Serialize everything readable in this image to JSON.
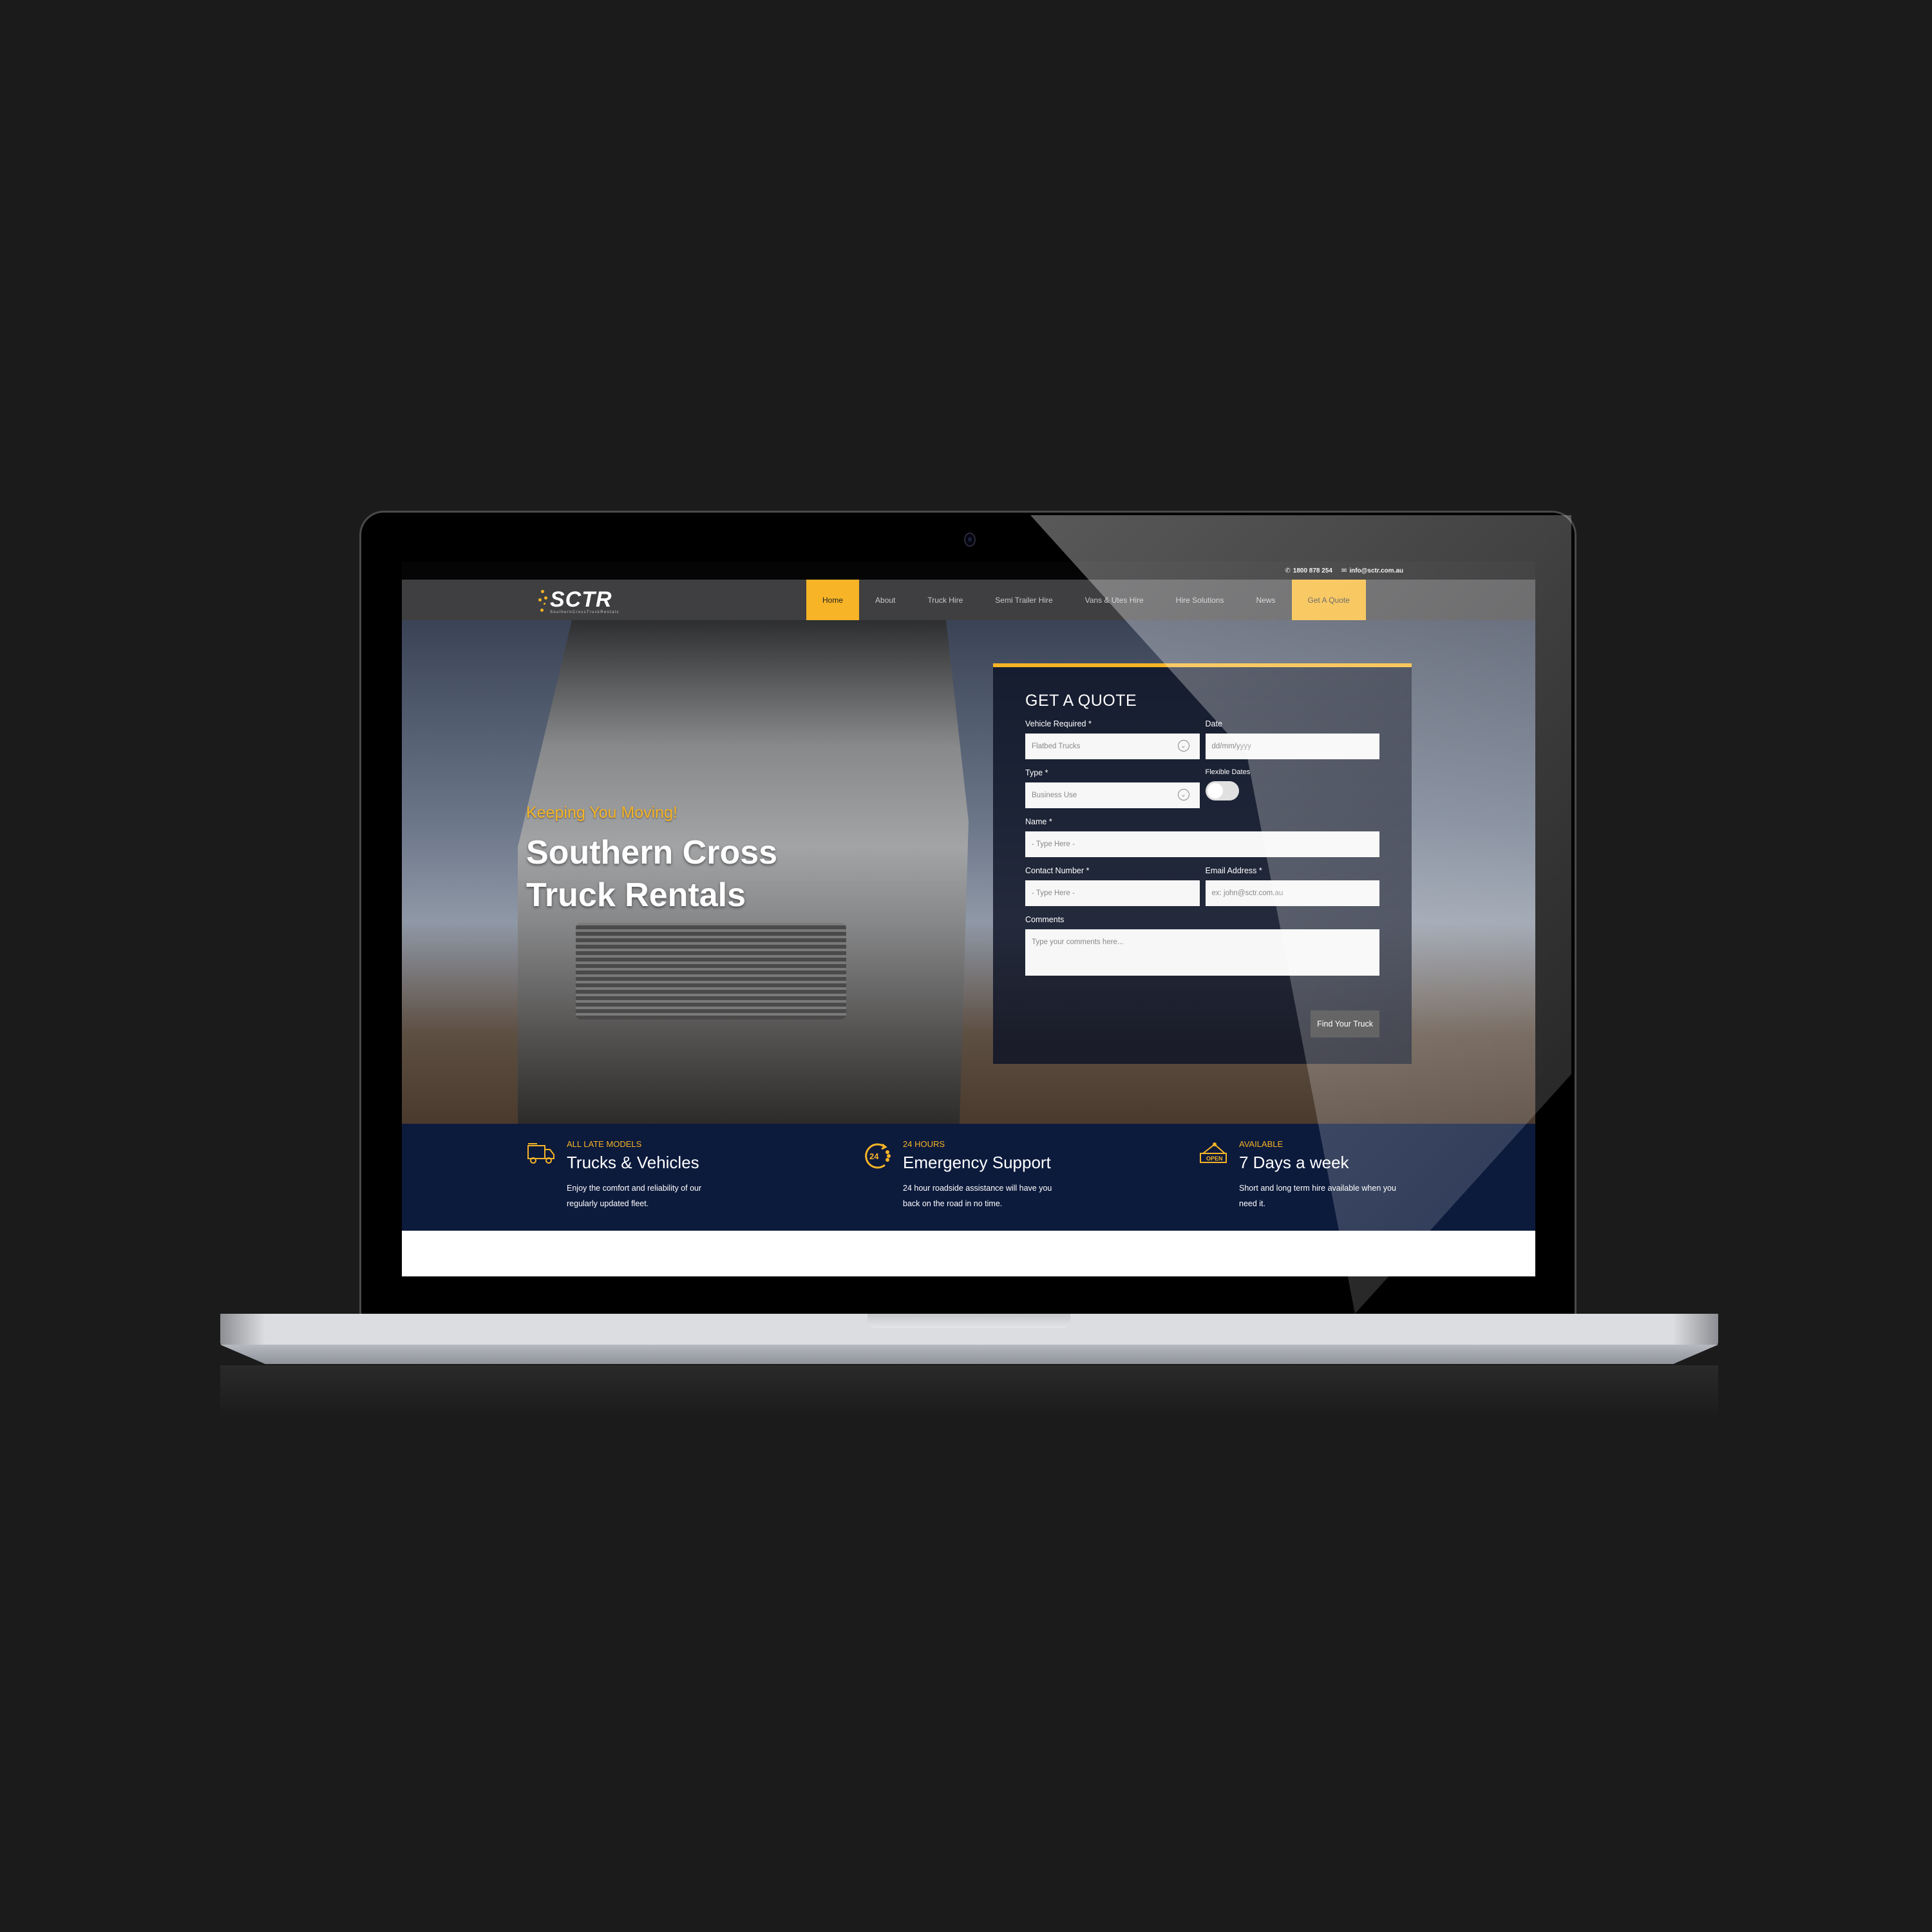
{
  "topbar": {
    "phone": "1800 878 254",
    "email": "info@sctr.com.au"
  },
  "logo": {
    "wordmark": "SCTR",
    "subtitle": "SouthernCrossTruckRentals"
  },
  "nav": {
    "items": [
      {
        "label": "Home",
        "state": "active"
      },
      {
        "label": "About"
      },
      {
        "label": "Truck Hire"
      },
      {
        "label": "Semi Trailer Hire"
      },
      {
        "label": "Vans & Utes Hire"
      },
      {
        "label": "Hire Solutions"
      },
      {
        "label": "News"
      },
      {
        "label": "Get A Quote",
        "state": "highlight"
      }
    ]
  },
  "hero": {
    "tagline": "Keeping You Moving!",
    "title_line1": "Southern Cross",
    "title_line2": "Truck Rentals"
  },
  "quote_form": {
    "heading": "GET A QUOTE",
    "vehicle_label": "Vehicle Required *",
    "vehicle_value": "Flatbed Trucks",
    "date_label": "Date",
    "date_placeholder": "dd/mm/yyyy",
    "type_label": "Type *",
    "type_value": "Business Use",
    "flexible_label": "Flexible Dates",
    "flexible_on": false,
    "name_label": "Name *",
    "name_placeholder": "- Type Here -",
    "contact_label": "Contact Number *",
    "contact_placeholder": "- Type Here -",
    "email_label": "Email Address *",
    "email_placeholder": "ex: john@sctr.com.au",
    "comments_label": "Comments",
    "comments_placeholder": "Type your comments here...",
    "submit_label": "Find Your Truck"
  },
  "features": [
    {
      "icon": "truck-icon",
      "kicker": "ALL LATE MODELS",
      "heading": "Trucks & Vehicles",
      "desc": "Enjoy the comfort and reliability of our regularly updated fleet."
    },
    {
      "icon": "24-hours-icon",
      "kicker": "24 HOURS",
      "heading": "Emergency Support",
      "desc": "24 hour roadside assistance will have you back on the road in no time."
    },
    {
      "icon": "open-sign-icon",
      "kicker": "AVAILABLE",
      "heading": "7 Days a week",
      "desc": "Short and long term hire available when you need it."
    }
  ],
  "icons": {
    "phone": "phone-icon",
    "email": "envelope-icon",
    "dropdown": "chevron-down-icon",
    "open_sign_text": "OPEN",
    "hours_text": "24"
  },
  "colors": {
    "accent": "#f6b426",
    "navy": "#0c1a3c",
    "nav_bg": "#3f3f41"
  }
}
